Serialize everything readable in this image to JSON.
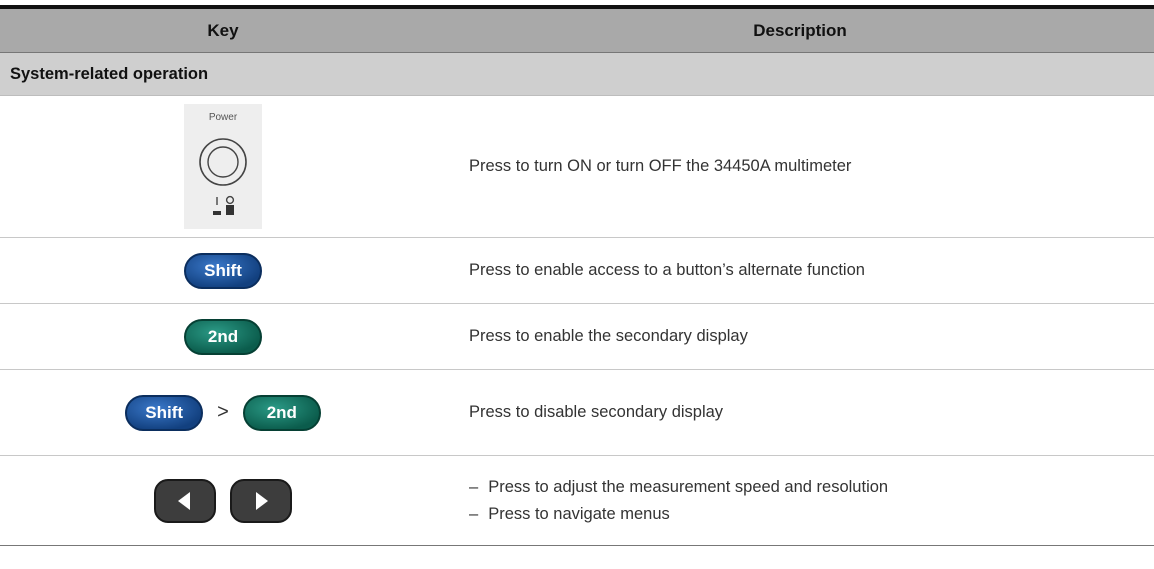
{
  "header": {
    "key_col": "Key",
    "desc_col": "Description"
  },
  "section": {
    "title": "System-related operation"
  },
  "rows": [
    {
      "key_label": "Power",
      "desc": "Press to turn ON or turn OFF the 34450A multimeter"
    },
    {
      "key_label": "Shift",
      "desc": "Press to enable access to a button’s alternate function"
    },
    {
      "key_label": "2nd",
      "desc": "Press to enable the secondary display"
    },
    {
      "key_label_1": "Shift",
      "separator": ">",
      "key_label_2": "2nd",
      "desc": "Press to disable secondary display"
    },
    {
      "bullets": [
        "Press to adjust the measurement speed and resolution",
        "Press to navigate menus"
      ],
      "dash": "–"
    }
  ],
  "icons": [
    "power-button-icon",
    "left-arrow-icon",
    "right-arrow-icon"
  ],
  "colors": {
    "header_bg": "#a9a9a9",
    "section_bg": "#cfcfcf",
    "shift_blue": "#1f5aa6",
    "second_green": "#0f7260"
  }
}
